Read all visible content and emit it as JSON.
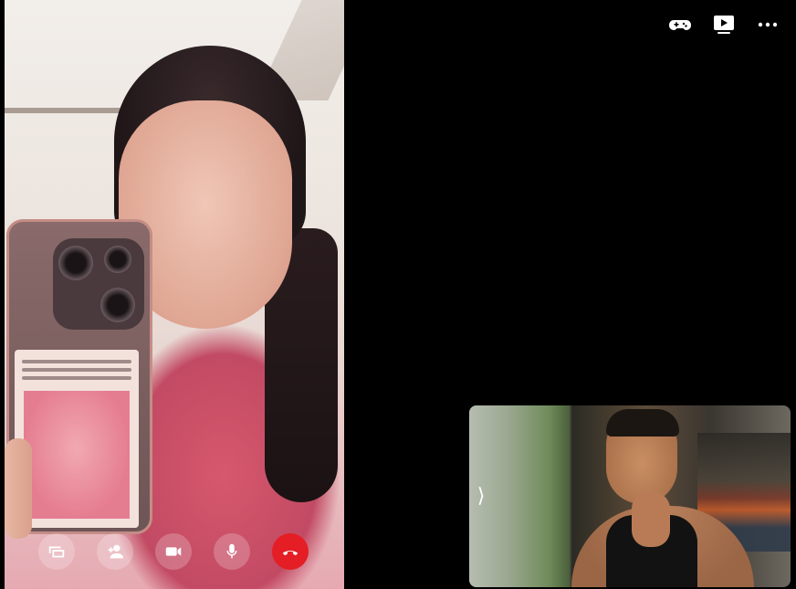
{
  "call": {
    "remote_video": {
      "description_icon": "remote-participant-video"
    },
    "controls": [
      {
        "id": "share-screen",
        "icon": "cast-screen-icon"
      },
      {
        "id": "add-participant",
        "icon": "add-person-icon"
      },
      {
        "id": "video-toggle",
        "icon": "video-camera-icon"
      },
      {
        "id": "mic-toggle",
        "icon": "microphone-icon"
      },
      {
        "id": "end-call",
        "icon": "hang-up-icon",
        "color": "#e41e24"
      }
    ],
    "toolbar": [
      {
        "id": "games",
        "icon": "gamepad-icon"
      },
      {
        "id": "watch-together",
        "icon": "play-screen-icon"
      },
      {
        "id": "more-options",
        "icon": "more-dots-icon"
      }
    ],
    "self_view": {
      "toggle_glyph": "⟩"
    }
  }
}
